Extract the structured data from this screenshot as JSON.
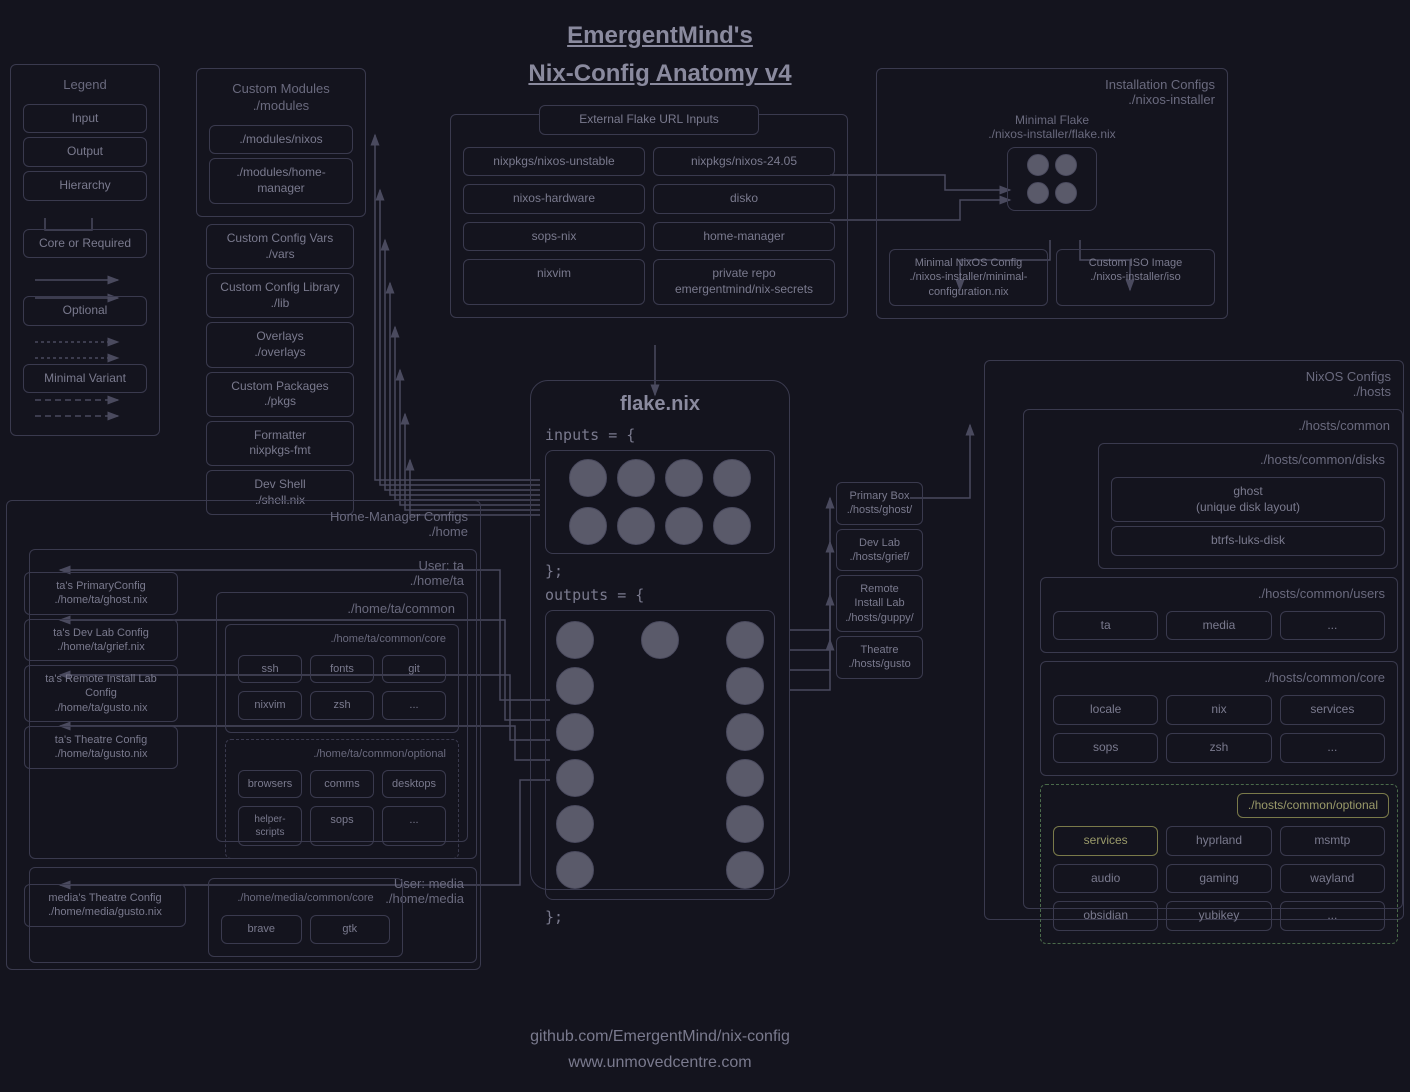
{
  "title": {
    "line1": "EmergentMind's",
    "line2": "Nix-Config Anatomy v4"
  },
  "footer": {
    "repo": "github.com/EmergentMind/nix-config",
    "site": "www.unmovedcentre.com"
  },
  "legend": {
    "heading": "Legend",
    "input": "Input",
    "output": "Output",
    "hierarchy": "Hierarchy",
    "core": "Core or Required",
    "optional": "Optional",
    "minimal": "Minimal Variant"
  },
  "custom_modules": {
    "heading": "Custom Modules\n./modules",
    "items": [
      "./modules/nixos",
      "./modules/home-manager"
    ]
  },
  "standalone": {
    "vars": "Custom Config Vars\n./vars",
    "lib": "Custom Config Library\n./lib",
    "overlays": "Overlays\n./overlays",
    "pkgs": "Custom Packages\n./pkgs",
    "formatter": "Formatter\nnixpkgs-fmt",
    "shell": "Dev Shell\n./shell.nix"
  },
  "external_flake": {
    "heading": "External Flake URL Inputs",
    "items": [
      "nixpkgs/nixos-unstable",
      "nixpkgs/nixos-24.05",
      "nixos-hardware",
      "disko",
      "sops-nix",
      "home-manager",
      "nixvim",
      "private repo\nemergentmind/nix-secrets"
    ]
  },
  "installer": {
    "heading": "Installation Configs\n./nixos-installer",
    "minimal_flake": "Minimal Flake\n./nixos-installer/flake.nix",
    "minimal_cfg": "Minimal NixOS Config\n./nixos-installer/minimal-configuration.nix",
    "iso": "Custom ISO Image\n./nixos-installer/iso"
  },
  "flake": {
    "heading": "flake.nix",
    "inputs": "inputs = {",
    "outputs": "outputs = {",
    "close": "};"
  },
  "hosts_targets": {
    "primary": "Primary Box\n./hosts/ghost/",
    "dev": "Dev Lab\n./hosts/grief/",
    "remote": "Remote Install Lab\n./hosts/guppy/",
    "theatre": "Theatre\n./hosts/gusto"
  },
  "nixos_configs": {
    "heading": "NixOS Configs\n./hosts",
    "common": "./hosts/common",
    "disks": {
      "heading": "./hosts/common/disks",
      "ghost": "ghost\n(unique disk layout)",
      "btrfs": "btrfs-luks-disk"
    },
    "users": {
      "heading": "./hosts/common/users",
      "items": [
        "ta",
        "media",
        "..."
      ]
    },
    "core": {
      "heading": "./hosts/common/core",
      "items": [
        "locale",
        "nix",
        "services",
        "sops",
        "zsh",
        "..."
      ]
    },
    "optional": {
      "heading": "./hosts/common/optional",
      "items": [
        "services",
        "hyprland",
        "msmtp",
        "audio",
        "gaming",
        "wayland",
        "obsidian",
        "yubikey",
        "..."
      ]
    }
  },
  "home_manager": {
    "heading": "Home-Manager Configs\n./home",
    "user_ta": {
      "heading": "User: ta\n./home/ta",
      "configs": [
        "ta's PrimaryConfig\n./home/ta/ghost.nix",
        "ta's Dev Lab Config\n./home/ta/grief.nix",
        "ta's Remote Install Lab Config\n./home/ta/gusto.nix",
        "ta's Theatre Config\n./home/ta/gusto.nix"
      ],
      "common": "./home/ta/common",
      "core": {
        "heading": "./home/ta/common/core",
        "items": [
          "ssh",
          "fonts",
          "git",
          "nixvim",
          "zsh",
          "..."
        ]
      },
      "optional": {
        "heading": "./home/ta/common/optional",
        "items": [
          "browsers",
          "comms",
          "desktops",
          "helper-scripts",
          "sops",
          "..."
        ]
      }
    },
    "user_media": {
      "heading": "User: media\n./home/media",
      "config": "media's Theatre Config\n./home/media/gusto.nix",
      "core": {
        "heading": "./home/media/common/core",
        "items": [
          "brave",
          "gtk"
        ]
      }
    }
  }
}
